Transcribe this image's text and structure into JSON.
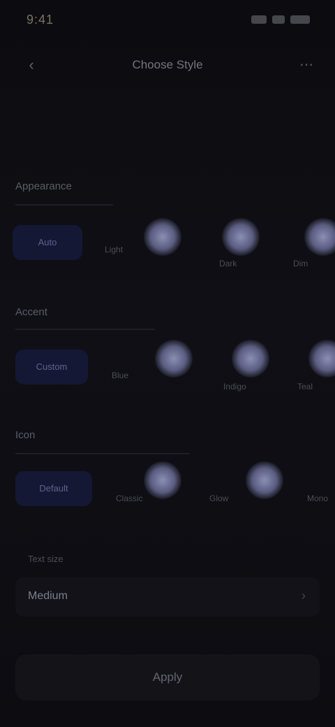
{
  "status_bar": {
    "time": "9:41"
  },
  "header": {
    "title": "Choose Style",
    "back_icon": "chevron-left-icon",
    "more_icon": "more-icon"
  },
  "sections": [
    {
      "title": "Appearance",
      "pill_label": "Auto",
      "items": [
        "Light",
        "Dark",
        "Dim"
      ]
    },
    {
      "title": "Accent",
      "pill_label": "Custom",
      "items": [
        "Blue",
        "Indigo",
        "Teal"
      ]
    },
    {
      "title": "Icon",
      "pill_label": "Default",
      "items": [
        "Classic",
        "Glow",
        "Mono"
      ]
    }
  ],
  "setting": {
    "label": "Text size",
    "value": "Medium"
  },
  "bottom_button": {
    "label": "Apply"
  },
  "colors": {
    "background": "#0d0d12",
    "accent": "#8b8fb5",
    "pill": "#151834"
  }
}
